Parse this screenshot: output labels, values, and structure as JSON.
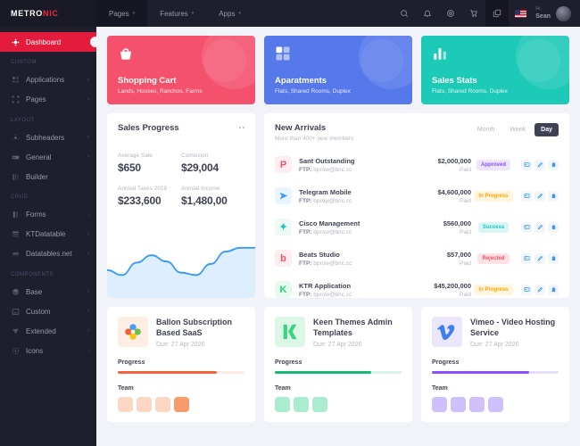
{
  "brand": {
    "part1": "METRO",
    "part2": "NIC"
  },
  "sidebar": {
    "items": [
      {
        "label": "Dashboard",
        "icon": "dashboard-icon",
        "active": true,
        "arrow": ""
      },
      {
        "section": "CUSTOM"
      },
      {
        "label": "Applications",
        "icon": "applications-icon",
        "arrow": "›"
      },
      {
        "label": "Pages",
        "icon": "pages-icon",
        "arrow": "›"
      },
      {
        "section": "LAYOUT"
      },
      {
        "label": "Subheaders",
        "icon": "subheaders-icon",
        "arrow": "›"
      },
      {
        "label": "General",
        "icon": "general-icon",
        "arrow": "›"
      },
      {
        "label": "Builder",
        "icon": "builder-icon",
        "arrow": ""
      },
      {
        "section": "CRUD"
      },
      {
        "label": "Forms",
        "icon": "forms-icon",
        "arrow": "›"
      },
      {
        "label": "KTDatatable",
        "icon": "datatable-icon",
        "arrow": "›"
      },
      {
        "label": "Datatables.net",
        "icon": "datatables-net-icon",
        "arrow": "›"
      },
      {
        "section": "COMPONENTS"
      },
      {
        "label": "Base",
        "icon": "base-icon",
        "arrow": "›"
      },
      {
        "label": "Custom",
        "icon": "custom-icon",
        "arrow": "›"
      },
      {
        "label": "Extended",
        "icon": "extended-icon",
        "arrow": "›"
      },
      {
        "label": "Icons",
        "icon": "icons-icon",
        "arrow": "›"
      }
    ]
  },
  "topbar": {
    "menu": [
      {
        "label": "Pages",
        "chevron": "▾"
      },
      {
        "label": "Features",
        "chevron": "▾"
      },
      {
        "label": "Apps",
        "chevron": "▾"
      }
    ],
    "icons": [
      "search-icon",
      "bell-icon",
      "gear-icon",
      "cart-icon",
      "layers-icon"
    ],
    "flag": "us-flag-icon",
    "greeting": "Hi,",
    "user_name": "Sean",
    "avatar": "user-avatar"
  },
  "stat_cards": [
    {
      "title": "Shopping Cart",
      "subtitle": "Lands, Houses, Ranchos, Farms",
      "color": "#f4516c",
      "icon": "basket-icon"
    },
    {
      "title": "Aparatments",
      "subtitle": "Flats, Shared Rooms, Duplex",
      "color": "#5578eb",
      "icon": "grid-icon"
    },
    {
      "title": "Sales Stats",
      "subtitle": "Flats, Shared Rooms, Duplex",
      "color": "#1dc9b7",
      "icon": "bars-icon"
    }
  ],
  "sales_progress": {
    "title": "Sales Progress",
    "menu_icon": "ellipsis-icon",
    "stats": [
      {
        "label": "Average Sale",
        "value": "$650"
      },
      {
        "label": "Comission",
        "value": "$29,004"
      },
      {
        "label": "Annual Taxes 2019",
        "value": "$233,600"
      },
      {
        "label": "Annual Income",
        "value": "$1,480,00"
      }
    ]
  },
  "chart_data": {
    "type": "area",
    "title": "Sales Progress",
    "xlabel": "",
    "ylabel": "",
    "grid": false,
    "legend": "none",
    "line_color": "#3699ff",
    "fill_color": "#ddeefe",
    "x": [
      0,
      1,
      2,
      3,
      4,
      5,
      6,
      7,
      8,
      9,
      10
    ],
    "values": [
      38,
      30,
      50,
      62,
      52,
      34,
      30,
      48,
      68,
      74,
      74
    ],
    "ylim": [
      0,
      100
    ]
  },
  "new_arrivals": {
    "title": "New Arrivals",
    "subtitle": "More than 400+ new members",
    "tabs": [
      {
        "label": "Month",
        "active": false
      },
      {
        "label": "Week",
        "active": false
      },
      {
        "label": "Day",
        "active": true
      }
    ],
    "rows": [
      {
        "logo": "P",
        "logo_bg": "#ffeef1",
        "logo_fg": "#f4516c",
        "name": "Sant Outstanding",
        "ftp_label": "FTP:",
        "ftp": "bprow@bnc.cc",
        "amount": "$2,000,000",
        "amount_label": "Paid",
        "badge": "Approved",
        "badge_bg": "#eee6fe",
        "badge_fg": "#8950fc"
      },
      {
        "logo": "➤",
        "logo_bg": "#e8f4ff",
        "logo_fg": "#3699ff",
        "name": "Telegram Mobile",
        "ftp_label": "FTP:",
        "ftp": "bprow@bnc.cc",
        "amount": "$4,600,000",
        "amount_label": "Paid",
        "badge": "In Progress",
        "badge_bg": "#fff4de",
        "badge_fg": "#ffa800"
      },
      {
        "logo": "✦",
        "logo_bg": "#eefaf2",
        "logo_fg": "#1bc5bd",
        "name": "Cisco Management",
        "ftp_label": "FTP:",
        "ftp": "bprow@bnc.cc",
        "amount": "$560,000",
        "amount_label": "Paid",
        "badge": "Success",
        "badge_bg": "#d8f7f4",
        "badge_fg": "#1bc5bd"
      },
      {
        "logo": "b",
        "logo_bg": "#ffeef1",
        "logo_fg": "#f64e60",
        "name": "Beats Studio",
        "ftp_label": "FTP:",
        "ftp": "bprow@bnc.cc",
        "amount": "$57,000",
        "amount_label": "Paid",
        "badge": "Rejected",
        "badge_bg": "#ffe2e5",
        "badge_fg": "#f64e60"
      },
      {
        "logo": "K",
        "logo_bg": "#e6fbee",
        "logo_fg": "#28d07b",
        "name": "KTR Application",
        "ftp_label": "FTP:",
        "ftp": "bprow@bnc.cc",
        "amount": "$45,200,000",
        "amount_label": "Paid",
        "badge": "In Progress",
        "badge_bg": "#fff4de",
        "badge_fg": "#ffa800"
      }
    ],
    "actions": [
      "view-icon",
      "edit-icon",
      "delete-icon"
    ]
  },
  "projects": [
    {
      "name": "Ballon Subscription Based SaaS",
      "due": "Due: 27 Apr 2020",
      "logo": "flower-icon",
      "logo_bg": "#fdeee4",
      "progress_label": "Progress",
      "progress": 78,
      "bar_color": "#f4623a",
      "bar_track": "#fdeae2",
      "team_label": "Team",
      "team": [
        "#fbd7c4",
        "#fbd7c4",
        "#fbd7c4",
        "#f79b6b"
      ]
    },
    {
      "name": "Keen Themes Admin Templates",
      "due": "Due: 27 Apr 2020",
      "logo": "keen-icon",
      "logo_bg": "#ddf7e7",
      "progress_label": "Progress",
      "progress": 76,
      "bar_color": "#17b978",
      "bar_track": "#d6f5e6",
      "team_label": "Team",
      "team": [
        "#a9ecd0",
        "#a9ecd0",
        "#a9ecd0"
      ]
    },
    {
      "name": "Vimeo - Video Hosting Service",
      "due": "Due: 27 Apr 2020",
      "logo": "vimeo-icon",
      "logo_bg": "#ece6fd",
      "progress_label": "Progress",
      "progress": 77,
      "bar_color": "#8950fc",
      "bar_track": "#e7defd",
      "team_label": "Team",
      "team": [
        "#cfc0fb",
        "#cfc0fb",
        "#cfc0fb",
        "#cfc0fb"
      ]
    }
  ]
}
